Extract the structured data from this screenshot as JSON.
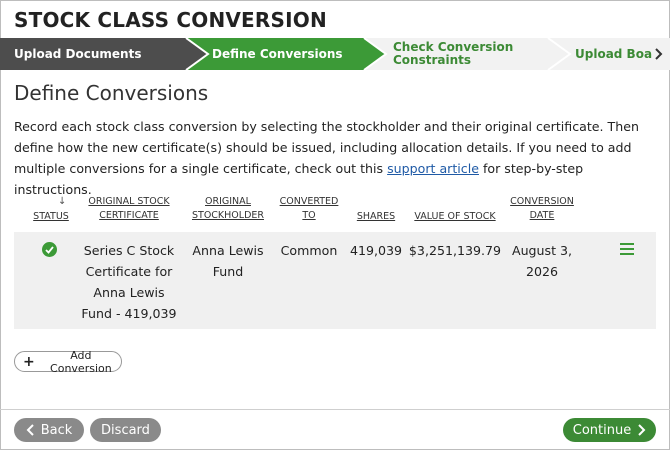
{
  "page": {
    "title": "STOCK CLASS CONVERSION"
  },
  "stepper": {
    "steps": [
      {
        "label": "Upload Documents",
        "state": "complete"
      },
      {
        "label": "Define Conversions",
        "state": "active"
      },
      {
        "label_line1": "Check Conversion",
        "label_line2": "Constraints",
        "state": "pending"
      },
      {
        "label": "Upload Board A",
        "state": "pending"
      }
    ],
    "next_icon": "chevron-right-icon"
  },
  "section": {
    "title": "Define Conversions",
    "intro_part1": "Record each stock class conversion by selecting the stockholder and their original certificate. Then define how the new certificate(s) should be issued, including allocation details. If you need to add multiple conversions for a single certificate, check out this ",
    "intro_link": "support article",
    "intro_part2": " for step-by-step instructions."
  },
  "table": {
    "headers": {
      "status": "STATUS",
      "certificate_1": "ORIGINAL STOCK",
      "certificate_2": "CERTIFICATE",
      "stockholder_1": "ORIGINAL",
      "stockholder_2": "STOCKHOLDER",
      "converted_1": "CONVERTED",
      "converted_2": "TO",
      "shares": "SHARES",
      "value": "VALUE OF STOCK",
      "date_1": "CONVERSION",
      "date_2": "DATE"
    },
    "sort_indicator": "↓",
    "rows": [
      {
        "status": "complete",
        "certificate_lines": [
          "Series C Stock",
          "Certificate for",
          "Anna Lewis",
          "Fund - 419,039"
        ],
        "stockholder_lines": [
          "Anna Lewis",
          "Fund"
        ],
        "converted_to": "Common",
        "shares": "419,039",
        "value": "$3,251,139.79",
        "date_lines": [
          "August 3,",
          "2026"
        ]
      }
    ]
  },
  "actions": {
    "add_conversion": "Add Conversion",
    "back": "Back",
    "discard": "Discard",
    "continue": "Continue"
  },
  "colors": {
    "primary_green": "#3c9a37",
    "dark_step": "#4d4d4d",
    "button_gray": "#8a8a8a",
    "row_bg": "#f0f0f0"
  }
}
